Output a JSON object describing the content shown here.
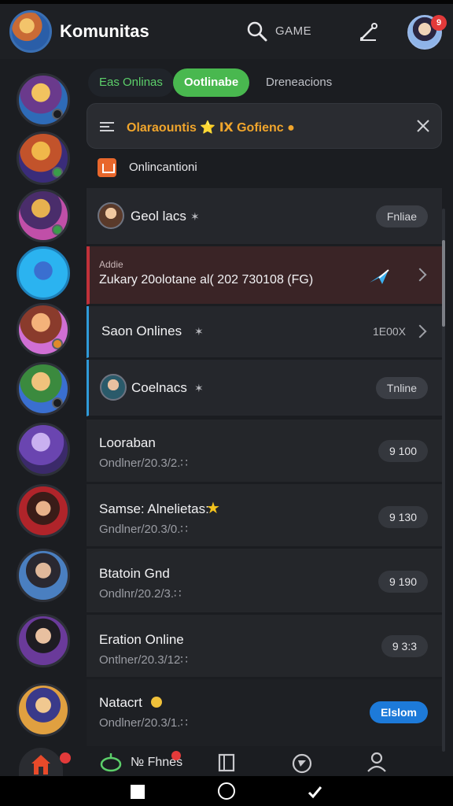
{
  "header": {
    "title": "Komunitas",
    "search_label": "GAME",
    "notification_count": "9"
  },
  "tabs": [
    {
      "label": "Eas Onlinas"
    },
    {
      "label": "Ootlinabe"
    },
    {
      "label": "Dreneacions"
    }
  ],
  "banner": {
    "text": "Olaraountis ⭐ Ⅸ Gofienc ●"
  },
  "subheader": {
    "text": "Onlincantioni"
  },
  "rows": [
    {
      "title": "Geol lacs",
      "spark": "✶",
      "pill": "Fnliae"
    },
    {
      "label": "Addie",
      "title": "Zukary 20olotane al( 202 730108 (FG)"
    },
    {
      "title": "Saon Onlines",
      "spark": "✶",
      "count": "1E00X"
    },
    {
      "title": "Coelnacs",
      "spark": "✶",
      "pill": "Tnline"
    },
    {
      "title": "Looraban",
      "sub": "Ondlner/20.3/2.∷",
      "count": "9 100"
    },
    {
      "title": "Samse: Alnelietas:",
      "sub": "Gndlner/20.3/0.∷",
      "count": "9 130"
    },
    {
      "title": "Btatoin Gnd",
      "sub": "Ondlnr/20.2/3.∷",
      "count": "9 190"
    },
    {
      "title": "Eration Online",
      "sub": "Ontlner/20.3/12∷",
      "count": "9 3:3"
    },
    {
      "title": "Natacrt",
      "sub": "Ondlner/20.3/1.∷",
      "pill": "Elslom"
    }
  ],
  "bottom_nav": {
    "active_label": "№ Fhnes"
  },
  "colors": {
    "accent_green": "#49b84f",
    "accent_orange": "#f0a52c",
    "highlight_red": "#c0313a",
    "accent_blue": "#1d7ad9"
  }
}
